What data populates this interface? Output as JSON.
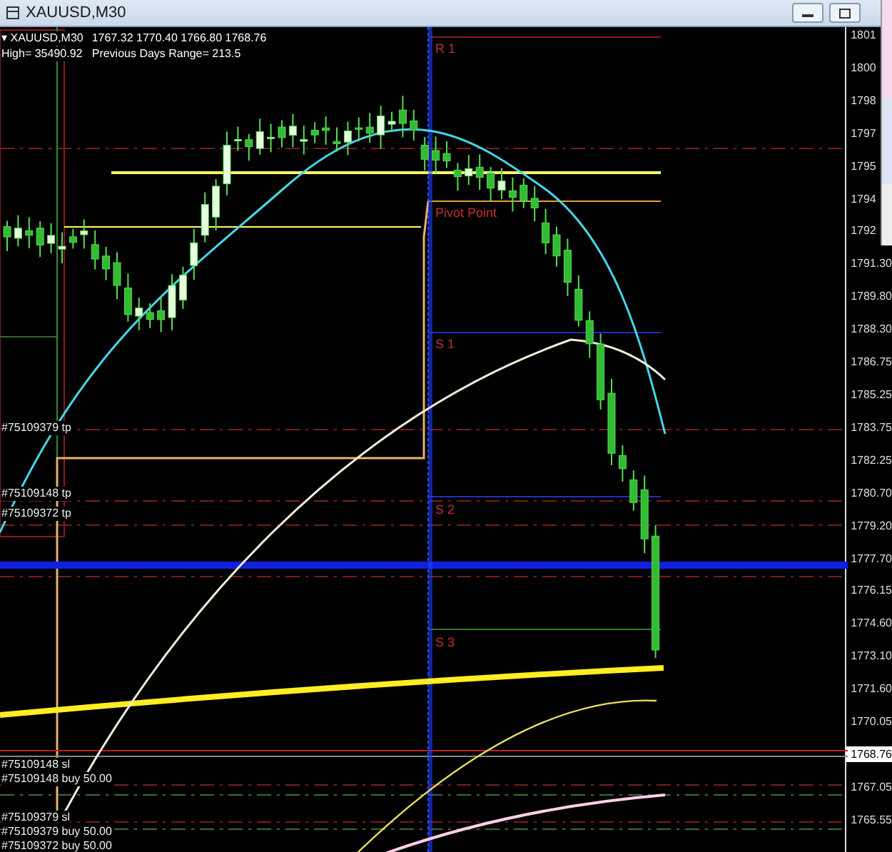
{
  "window": {
    "title": "XAUUSD,M30"
  },
  "chart_header": {
    "marker": "▾",
    "symbol": "XAUUSD,M30",
    "ohlc": "1767.32 1770.40 1766.80 1768.76",
    "high": "High= 35490.92",
    "range": "Previous Days Range= 213.5"
  },
  "pivot_labels": [
    "R 1",
    "Pivot Point",
    "S 1",
    "S 2",
    "S 3"
  ],
  "order_labels": [
    "#75109379 tp",
    "#75109148 tp",
    "#75109372 tp",
    "#75109148 sl",
    "#75109148 buy 50.00",
    "#75109379 sl",
    "#75109379 buy 50.00",
    "#75109372 buy 50.00"
  ],
  "price_axis": [
    {
      "label": "1801",
      "current": false
    },
    {
      "label": "1800",
      "current": false
    },
    {
      "label": "1798",
      "current": false
    },
    {
      "label": "1797",
      "current": false
    },
    {
      "label": "1795",
      "current": false
    },
    {
      "label": "1794",
      "current": false
    },
    {
      "label": "1792",
      "current": false
    },
    {
      "label": "1791.30",
      "current": false
    },
    {
      "label": "1789.80",
      "current": false
    },
    {
      "label": "1788.30",
      "current": false
    },
    {
      "label": "1786.75",
      "current": false
    },
    {
      "label": "1785.25",
      "current": false
    },
    {
      "label": "1783.75",
      "current": false
    },
    {
      "label": "1782.25",
      "current": false
    },
    {
      "label": "1780.70",
      "current": false
    },
    {
      "label": "1779.20",
      "current": false
    },
    {
      "label": "1777.70",
      "current": false
    },
    {
      "label": "1776.15",
      "current": false
    },
    {
      "label": "1774.60",
      "current": false
    },
    {
      "label": "1773.10",
      "current": false
    },
    {
      "label": "1771.60",
      "current": false
    },
    {
      "label": "1770.05",
      "current": false
    },
    {
      "label": "1768.76",
      "current": true
    },
    {
      "label": "1767.05",
      "current": false
    },
    {
      "label": "1765.55",
      "current": false
    }
  ]
}
